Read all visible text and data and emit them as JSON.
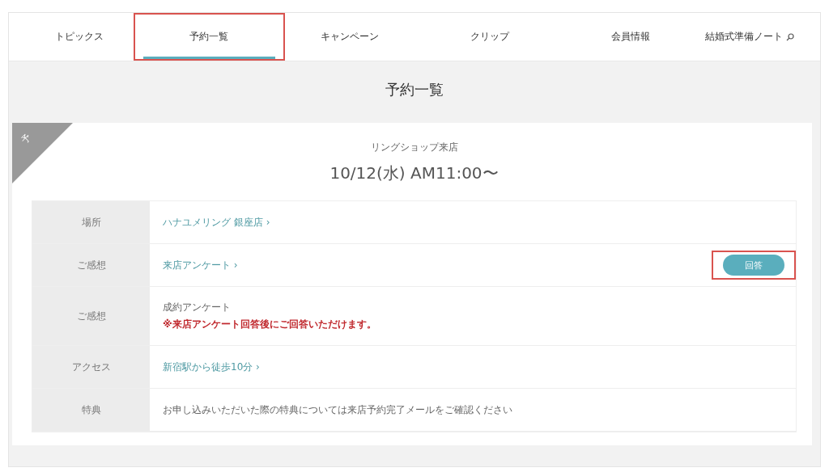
{
  "tabs": [
    {
      "label": "トピックス",
      "selected": false,
      "highlighted": false
    },
    {
      "label": "予約一覧",
      "selected": true,
      "highlighted": true
    },
    {
      "label": "キャンペーン",
      "selected": false,
      "highlighted": false
    },
    {
      "label": "クリップ",
      "selected": false,
      "highlighted": false
    },
    {
      "label": "会員情報",
      "selected": false,
      "highlighted": false
    },
    {
      "label": "結婚式準備ノート",
      "selected": false,
      "highlighted": false,
      "external": true
    }
  ],
  "page_title": "予約一覧",
  "reservation": {
    "corner_badge": "予",
    "type": "リングショップ来店",
    "datetime": "10/12(水) AM11:00〜",
    "rows": [
      {
        "kind": "link",
        "label": "場所",
        "text": "ハナユメリング 銀座店 ›"
      },
      {
        "kind": "link",
        "label": "ご感想",
        "text": "来店アンケート ›",
        "button": {
          "label": "回答",
          "highlighted": true
        }
      },
      {
        "kind": "note",
        "label": "ご感想",
        "text": "成約アンケート",
        "note": "※来店アンケート回答後にご回答いただけます。"
      },
      {
        "kind": "link",
        "label": "アクセス",
        "text": "新宿駅から徒歩10分 ›"
      },
      {
        "kind": "text",
        "label": "特典",
        "text": "お申し込みいただいた際の特典については来店予約完了メールをご確認ください"
      }
    ]
  }
}
